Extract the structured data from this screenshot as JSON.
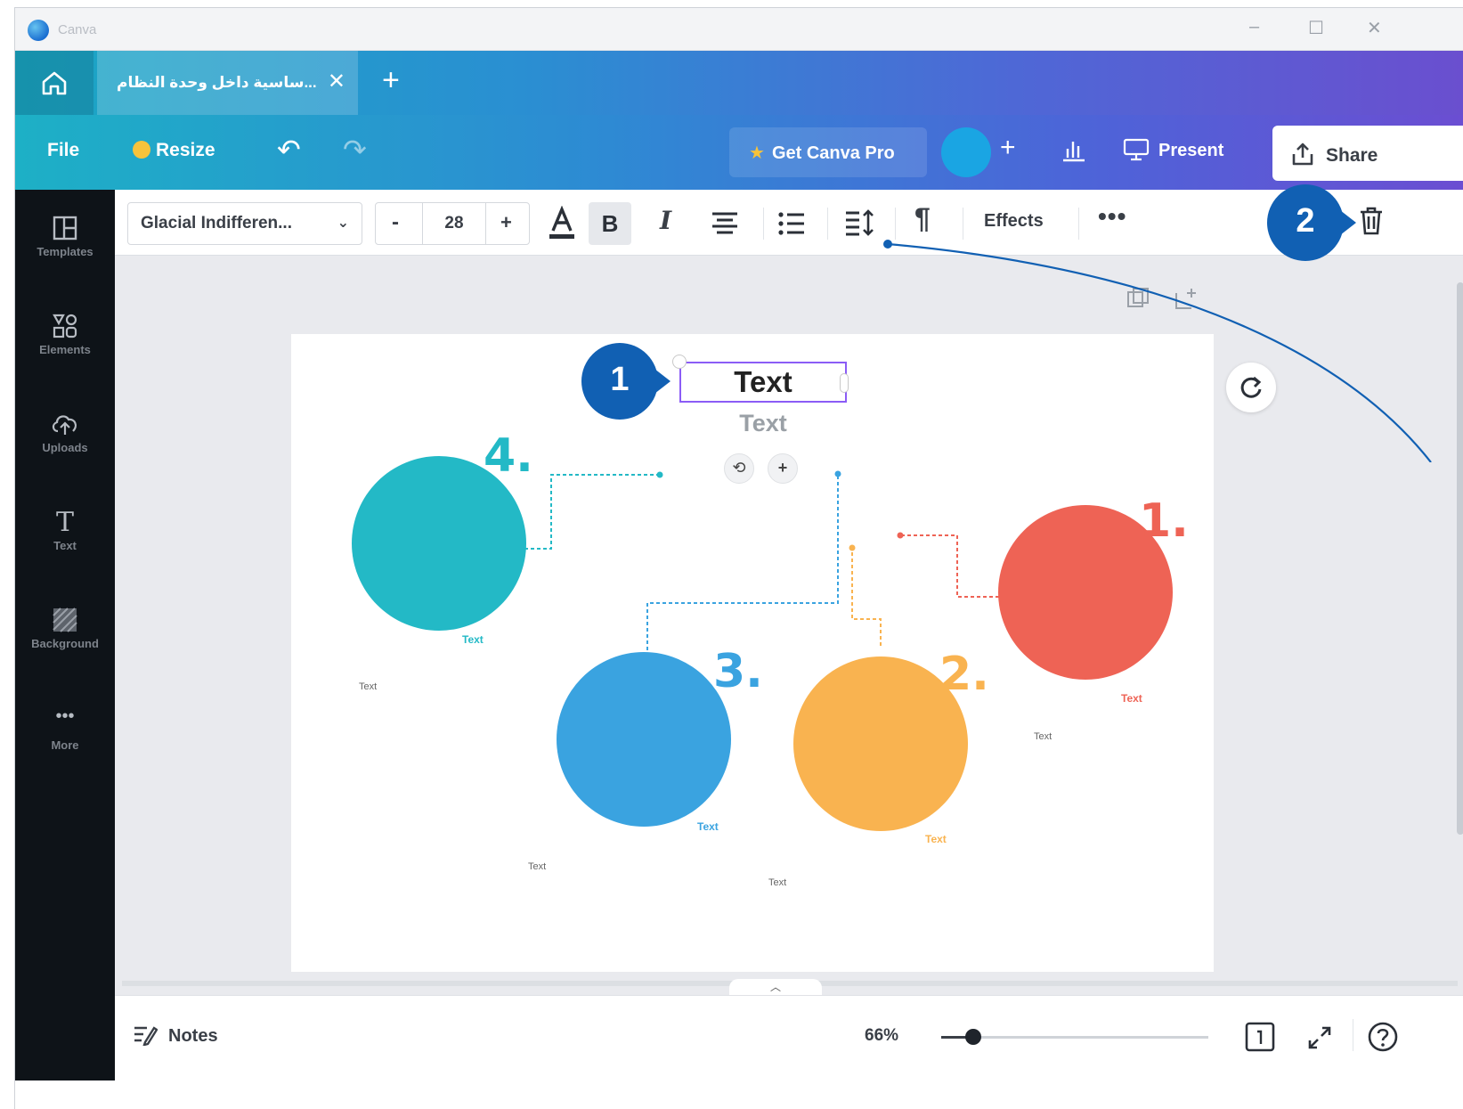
{
  "window": {
    "app_name": "Canva",
    "minimize": "–",
    "maximize": "☐",
    "close": "✕"
  },
  "tabs": {
    "active_tab_title": "...ساسية داخل وحدة النظام",
    "close": "✕",
    "add": "+"
  },
  "menu": {
    "file": "File",
    "resize": "Resize",
    "get_pro": "Get Canva Pro",
    "add_collab": "+",
    "present": "Present",
    "share": "Share"
  },
  "sidebar": {
    "items": [
      {
        "label": "Templates",
        "icon": "templates-icon"
      },
      {
        "label": "Elements",
        "icon": "elements-icon"
      },
      {
        "label": "Uploads",
        "icon": "uploads-icon"
      },
      {
        "label": "Text",
        "icon": "text-icon"
      },
      {
        "label": "Background",
        "icon": "background-icon"
      },
      {
        "label": "More",
        "icon": "more-icon"
      }
    ]
  },
  "toolbar": {
    "font_name": "Glacial Indifferen...",
    "font_size": "28",
    "minus": "-",
    "plus": "+",
    "bold": "B",
    "italic": "I",
    "effects": "Effects",
    "more": "•••"
  },
  "canvas": {
    "selected_text": "Text",
    "sub_text": "Text",
    "items": [
      {
        "number": "4.",
        "label": "Text",
        "color": "#23b9c6"
      },
      {
        "number": "3.",
        "label": "Text",
        "color": "#3aa3e0"
      },
      {
        "number": "2.",
        "label": "Text",
        "color": "#f9b350"
      },
      {
        "number": "1.",
        "label": "Text",
        "color": "#ee6355"
      }
    ],
    "placeholder_texts": [
      "Text",
      "Text",
      "Text",
      "Text"
    ]
  },
  "callouts": {
    "first": "1",
    "second": "2"
  },
  "footer": {
    "notes": "Notes",
    "zoom": "66%",
    "zoom_level": 0.12
  },
  "colors": {
    "callout": "#1160b3",
    "selection": "#8b5cf6"
  }
}
